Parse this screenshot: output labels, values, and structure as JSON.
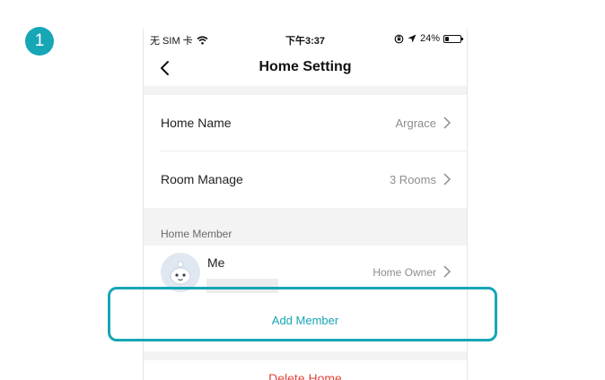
{
  "step": {
    "number": "1"
  },
  "status_bar": {
    "carrier": "无 SIM 卡",
    "time": "下午3:37",
    "battery": "24%",
    "battery_level": 0.24,
    "icons": [
      "wifi-icon",
      "orientation-lock-icon",
      "location-arrow-icon",
      "battery-icon"
    ]
  },
  "nav": {
    "title": "Home Setting",
    "back_icon": "chevron-left-icon"
  },
  "settings": {
    "rows": [
      {
        "label": "Home Name",
        "value": "Argrace"
      },
      {
        "label": "Room Manage",
        "value": "3 Rooms"
      }
    ]
  },
  "members": {
    "header": "Home Member",
    "items": [
      {
        "name": "Me",
        "role": "Home Owner"
      }
    ],
    "add_label": "Add Member"
  },
  "actions": {
    "delete_label": "Delete Home"
  },
  "colors": {
    "accent": "#16a6b6",
    "danger": "#e0463a",
    "background": "#f3f3f3"
  }
}
